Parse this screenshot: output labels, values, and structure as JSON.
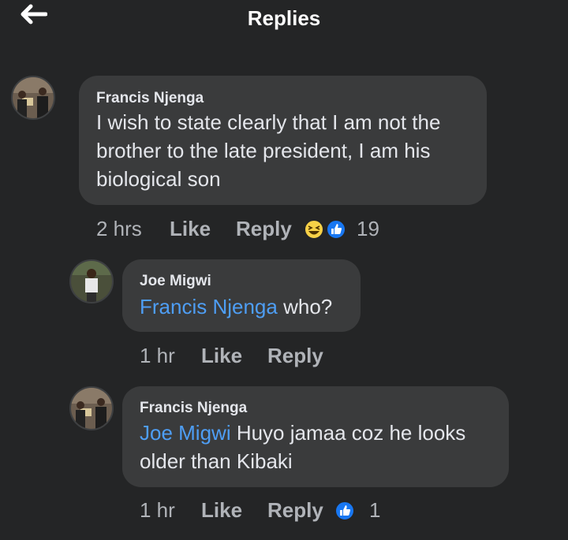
{
  "header": {
    "title": "Replies",
    "back_icon": "arrow-left-icon"
  },
  "colors": {
    "background": "#242526",
    "bubble": "#3a3b3c",
    "mention": "#4e9ef5",
    "like_blue": "#1877f2",
    "haha_yellow": "#f7d147"
  },
  "comments": [
    {
      "author": "Francis Njenga",
      "text": "I wish to state clearly that I am not the brother to the late president, I am his biological son",
      "time": "2 hrs",
      "like_label": "Like",
      "reply_label": "Reply",
      "reactions": [
        "haha-reaction-icon",
        "like-reaction-icon"
      ],
      "reaction_count": "19"
    },
    {
      "author": "Joe Migwi",
      "mention": "Francis Njenga",
      "text": " who?",
      "time": "1 hr",
      "like_label": "Like",
      "reply_label": "Reply"
    },
    {
      "author": "Francis Njenga",
      "mention": "Joe Migwi",
      "text": " Huyo jamaa coz he looks older than Kibaki",
      "time": "1 hr",
      "like_label": "Like",
      "reply_label": "Reply",
      "reactions": [
        "like-reaction-icon"
      ],
      "reaction_count": "1"
    }
  ]
}
